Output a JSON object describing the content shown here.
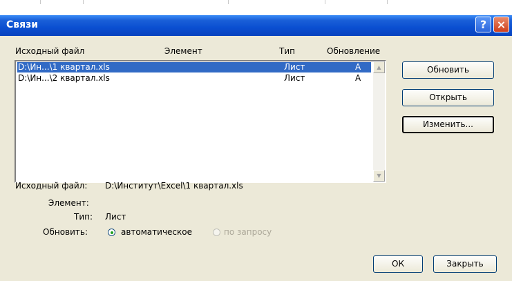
{
  "window": {
    "title": "Связи"
  },
  "titlebar": {
    "help_glyph": "?",
    "close_glyph": "×"
  },
  "list": {
    "headers": {
      "source": "Исходный файл",
      "element": "Элемент",
      "type": "Тип",
      "update": "Обновление"
    },
    "rows": [
      {
        "source": "D:\\Ин...\\1 квартал.xls",
        "element": "",
        "type": "Лист",
        "update": "А",
        "selected": true
      },
      {
        "source": "D:\\Ин...\\2 квартал.xls",
        "element": "",
        "type": "Лист",
        "update": "А",
        "selected": false
      }
    ]
  },
  "buttons": {
    "update": "Обновить",
    "open": "Открыть",
    "change": "Изменить...",
    "ok": "ОК",
    "close": "Закрыть"
  },
  "details": {
    "source_label": "Исходный файл:",
    "source_value": "D:\\Институт\\Excel\\1 квартал.xls",
    "element_label": "Элемент:",
    "element_value": "",
    "type_label": "Тип:",
    "type_value": "Лист",
    "update_label": "Обновить:",
    "option_auto": "автоматическое",
    "option_manual": "по запросу",
    "auto_selected": true
  },
  "colors": {
    "title_gradient": "#0a4fd1",
    "selection": "#316ac5",
    "dialog_bg": "#ece9d8"
  }
}
